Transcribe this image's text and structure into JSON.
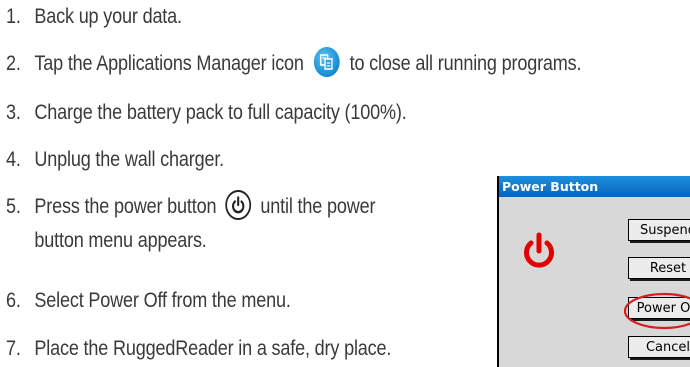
{
  "steps": [
    {
      "num": "1.",
      "text": "Back up your data."
    },
    {
      "num": "2.",
      "text_before": "Tap the Applications Manager icon",
      "text_after": "to close all running programs."
    },
    {
      "num": "3.",
      "text": "Charge the battery pack to full capacity (100%)."
    },
    {
      "num": "4.",
      "text": "Unplug the wall charger."
    },
    {
      "num": "5.",
      "text_before": "Press the power button",
      "text_after": "until the power",
      "line2": "button menu appears."
    },
    {
      "num": "6.",
      "text": "Select Power Off from the menu."
    },
    {
      "num": "7.",
      "text": "Place the RuggedReader in a safe, dry place."
    }
  ],
  "dialog": {
    "title": "Power Button",
    "buttons": [
      "Suspend",
      "Reset",
      "Power Off",
      "Cancel"
    ],
    "highlighted_button": "Power Off"
  },
  "icons": {
    "app_manager": "applications-manager-icon",
    "power": "power-icon"
  },
  "colors": {
    "text": "#3a3a3a",
    "title_bar": "#0a63b8",
    "power_symbol": "#e00000",
    "highlight_oval": "#d42020",
    "app_icon_blue": "#1d93d6"
  }
}
